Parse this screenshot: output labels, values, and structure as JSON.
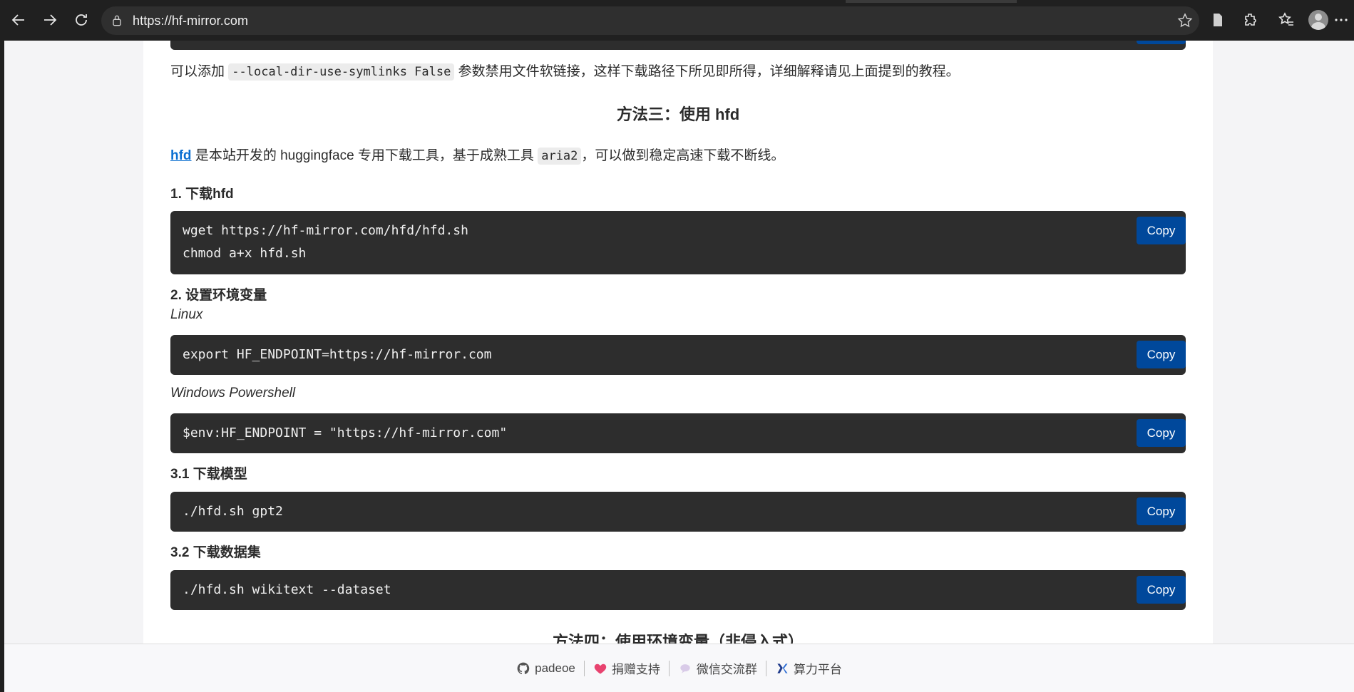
{
  "browser": {
    "url": "https://hf-mirror.com"
  },
  "content": {
    "top_note_prefix": "可以添加",
    "top_note_code": "--local-dir-use-symlinks False",
    "top_note_suffix": "参数禁用文件软链接，这样下载路径下所见即所得，详细解释请见上面提到的教程。",
    "method3_title": "方法三：使用 hfd",
    "hfd_link": "hfd",
    "hfd_desc_1": "是本站开发的 huggingface 专用下载工具，基于成熟工具",
    "hfd_desc_code": "aria2",
    "hfd_desc_2": "，可以做到稳定高速下载不断线。",
    "step1_title": "1. 下载hfd",
    "step1_code": [
      "wget https://hf-mirror.com/hfd/hfd.sh",
      "chmod a+x hfd.sh"
    ],
    "step2_title": "2. 设置环境变量",
    "linux_label": "Linux",
    "linux_code": "export HF_ENDPOINT=https://hf-mirror.com",
    "windows_label": "Windows Powershell",
    "windows_code": "$env:HF_ENDPOINT = \"https://hf-mirror.com\"",
    "step31_title": "3.1 下载模型",
    "step31_code": "./hfd.sh gpt2",
    "step32_title": "3.2 下载数据集",
    "step32_code": "./hfd.sh wikitext --dataset",
    "method4_title": "方法四：使用环境变量（非侵入式）",
    "copy_label": "Copy"
  },
  "footer": {
    "items": [
      "padeoe",
      "捐赠支持",
      "微信交流群",
      "算力平台"
    ]
  },
  "colors": {
    "copy_button": "#00489b",
    "code_bg": "#2d2d2d",
    "link": "#0b6fd1"
  },
  "icons": {
    "footer": [
      "github-icon",
      "heart-icon",
      "chat-bubble-icon",
      "x-logo-icon"
    ]
  }
}
